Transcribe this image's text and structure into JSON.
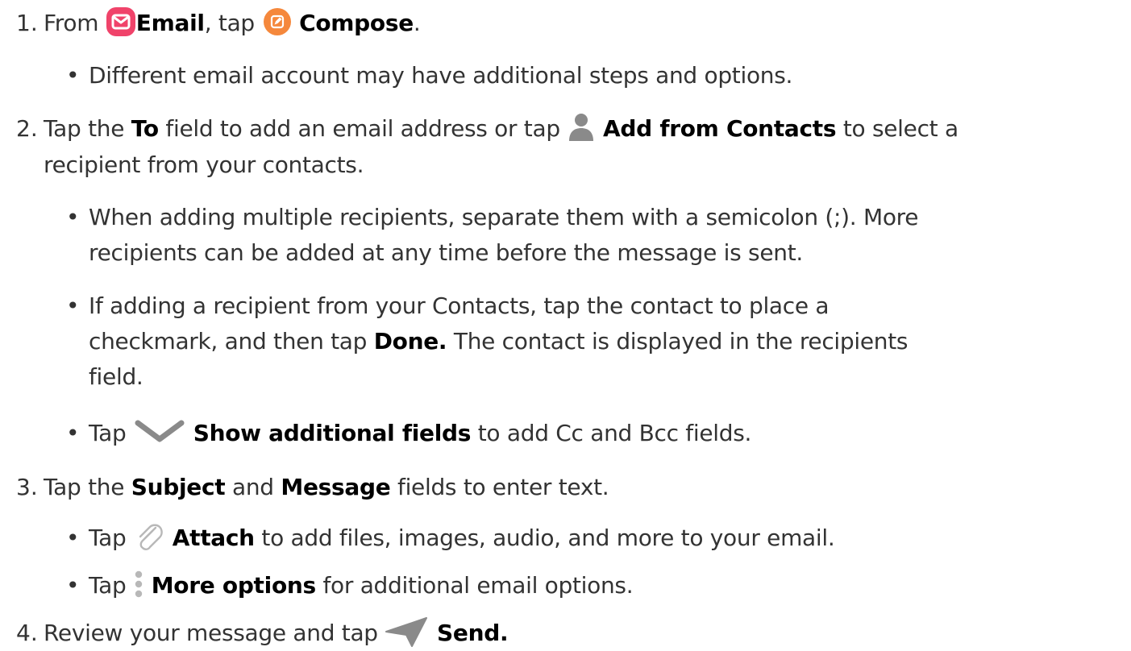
{
  "colors": {
    "text": "#333333",
    "bold_text": "#000000",
    "email_icon": "#f0436a",
    "compose_icon": "#f5883c",
    "gray_icon": "#8a8a8a"
  },
  "steps": [
    {
      "number": "1.",
      "parts": {
        "a": "From",
        "email_icon": "email-app-icon",
        "b": "Email",
        "c": ", tap",
        "compose_icon": "compose-icon",
        "d": "Compose",
        "e": "."
      },
      "bullets": [
        {
          "text": "Different email account may have additional steps and options."
        }
      ]
    },
    {
      "number": "2.",
      "line1": {
        "a": "Tap the",
        "b": "To",
        "c": "field to add an email address or tap",
        "contact_icon": "person-icon",
        "d": "Add from Contacts",
        "e": "to select a"
      },
      "line2": "recipient from your contacts.",
      "bullets": [
        {
          "line1": "When adding multiple recipients, separate them with a semicolon (;). More",
          "line2": "recipients can be added at any time before the message is sent."
        },
        {
          "line1": "If adding a recipient from your Contacts, tap the contact to place a",
          "line2a": "checkmark, and then tap",
          "line2b": "Done.",
          "line2c": "The contact is displayed in the recipients",
          "line3": "field."
        },
        {
          "a": "Tap",
          "icon": "chevron-down-icon",
          "b": "Show additional fields",
          "c": "to add Cc and Bcc fields."
        }
      ]
    },
    {
      "number": "3.",
      "parts": {
        "a": "Tap the",
        "b": "Subject",
        "c": "and",
        "d": "Message",
        "e": "fields to enter text."
      },
      "bullets": [
        {
          "a": "Tap",
          "icon": "paperclip-icon",
          "b": "Attach",
          "c": "to add files, images, audio, and more to your email."
        },
        {
          "a": "Tap",
          "icon": "more-options-icon",
          "b": "More options",
          "c": "for additional email options."
        }
      ]
    },
    {
      "number": "4.",
      "parts": {
        "a": "Review your message and tap",
        "icon": "send-icon",
        "b": "Send."
      }
    }
  ]
}
